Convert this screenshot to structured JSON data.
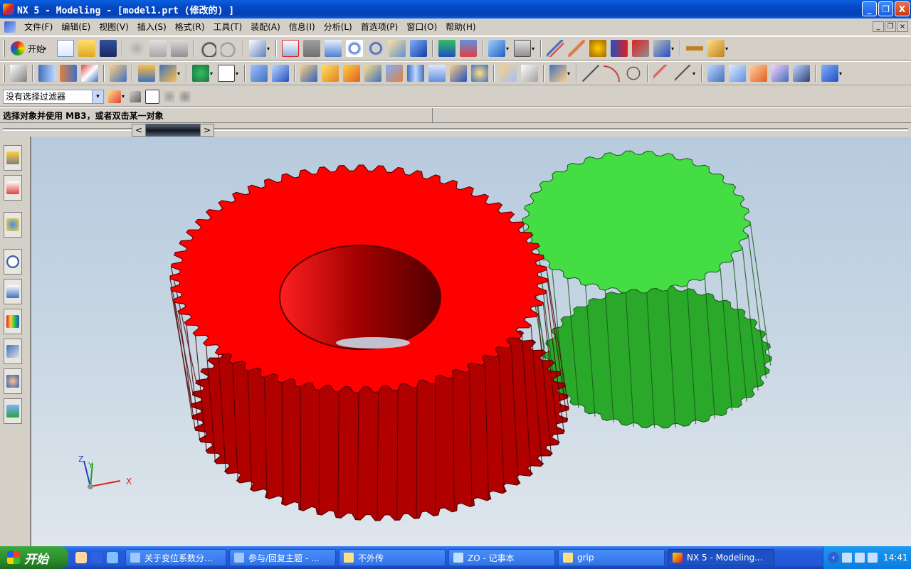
{
  "window": {
    "title": "NX 5 - Modeling - [model1.prt (修改的) ]",
    "min_label": "_",
    "max_label": "❐",
    "close_label": "X"
  },
  "menu": {
    "items": [
      "文件(F)",
      "编辑(E)",
      "视图(V)",
      "插入(S)",
      "格式(R)",
      "工具(T)",
      "装配(A)",
      "信息(I)",
      "分析(L)",
      "首选项(P)",
      "窗口(O)",
      "帮助(H)"
    ]
  },
  "toolbar": {
    "start_label": "开始",
    "dropdown_glyph": "▾"
  },
  "selection": {
    "filter_value": "没有选择过滤器"
  },
  "status": {
    "cue": "选择对象并使用 MB3，或者双击某一对象"
  },
  "scroller": {
    "left": "<",
    "right": ">"
  },
  "axis": {
    "x": "X",
    "y": "Y",
    "z": "Z"
  },
  "colors": {
    "red_gear": "#ff0000",
    "green_gear": "#44dd44",
    "background_top": "#b7cbde",
    "background_bottom": "#dfe6ec"
  },
  "taskbar": {
    "start": "开始",
    "tasks": [
      {
        "label": "关于变位系数分..."
      },
      {
        "label": "参与/回复主题 - ..."
      },
      {
        "label": "不外传"
      },
      {
        "label": "ZO - 记事本"
      },
      {
        "label": "grip"
      },
      {
        "label": "NX 5 - Modeling..."
      }
    ],
    "time": "14:41"
  }
}
